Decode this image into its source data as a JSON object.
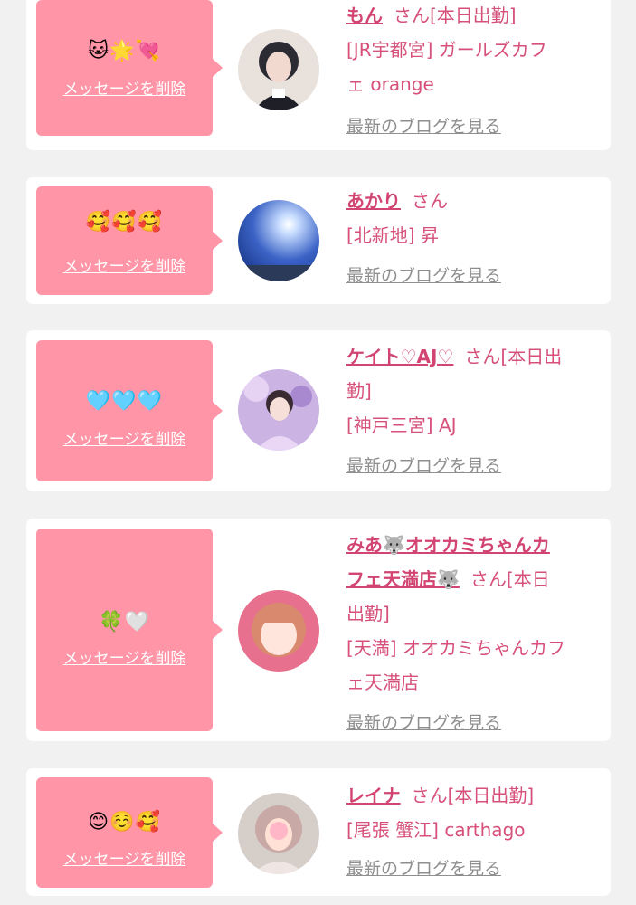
{
  "messages": [
    {
      "emojis": "🐱🌟💘",
      "delete_label": "メッセージを削除",
      "name": "もん",
      "honorific": "さん[本日出勤]",
      "shop_lines": [
        "[JR宇都宮] ガールズカフ",
        "ェ orange"
      ],
      "blog_label": "最新のブログを見る",
      "avatar_colors": [
        "#2a2a33",
        "#d8cfca"
      ]
    },
    {
      "emojis": "🥰🥰🥰",
      "delete_label": "メッセージを削除",
      "name": "あかり",
      "honorific": "さん",
      "shop_lines": [
        "[北新地] 昇"
      ],
      "blog_label": "最新のブログを見る",
      "avatar_colors": [
        "#1e3c8c",
        "#d8e8ff"
      ]
    },
    {
      "emojis": "🩵🩵🩵",
      "delete_label": "メッセージを削除",
      "name": "ケイト♡AJ♡",
      "honorific": "さん[本日出",
      "honorific_line2": "勤]",
      "shop_lines": [
        "[神戸三宮] AJ"
      ],
      "blog_label": "最新のブログを見る",
      "avatar_colors": [
        "#b79ad6",
        "#f3e8f8"
      ]
    },
    {
      "emojis": "🍀🤍",
      "delete_label": "メッセージを削除",
      "name_line1": "みあ🐺オオカミちゃんカ",
      "name_line2": "フェ天満店🐺",
      "honorific": "さん[本日",
      "honorific_line2": "出勤]",
      "shop_lines": [
        "[天満] オオカミちゃんカフ",
        "ェ天満店"
      ],
      "blog_label": "最新のブログを見る",
      "avatar_colors": [
        "#e2708c",
        "#ffe2d6"
      ]
    },
    {
      "emojis": "😊☺️🥰",
      "delete_label": "メッセージを削除",
      "name": "レイナ",
      "honorific": "さん[本日出勤]",
      "shop_lines": [
        "[尾張 蟹江] carthago"
      ],
      "blog_label": "最新のブログを見る",
      "avatar_colors": [
        "#c9c2bd",
        "#f2dccf"
      ]
    }
  ]
}
